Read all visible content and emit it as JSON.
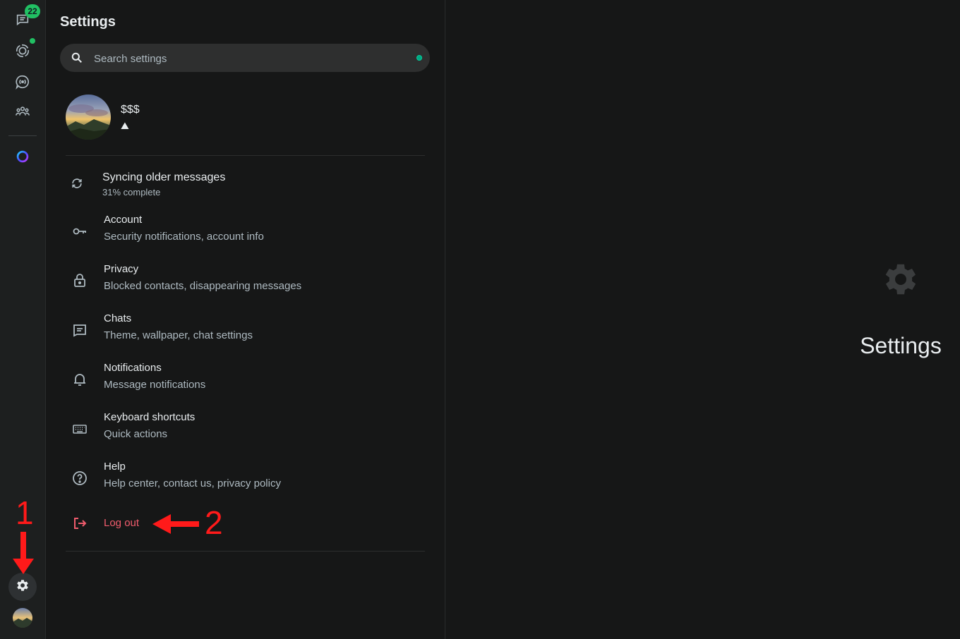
{
  "rail": {
    "chats_badge": "22",
    "items": [
      "chats-icon",
      "status-icon",
      "channels-icon",
      "communities-icon",
      "meta-ai-icon"
    ],
    "settings_icon": "gear-icon"
  },
  "settings": {
    "title": "Settings",
    "search_placeholder": "Search settings",
    "profile": {
      "name": "$$$",
      "about": "⛰"
    },
    "sync": {
      "title": "Syncing older messages",
      "progress": "31% complete",
      "progress_value": 31
    },
    "items": [
      {
        "icon": "key-icon",
        "title": "Account",
        "subtitle": "Security notifications, account info"
      },
      {
        "icon": "lock-icon",
        "title": "Privacy",
        "subtitle": "Blocked contacts, disappearing messages"
      },
      {
        "icon": "chat-icon",
        "title": "Chats",
        "subtitle": "Theme, wallpaper, chat settings"
      },
      {
        "icon": "bell-icon",
        "title": "Notifications",
        "subtitle": "Message notifications"
      },
      {
        "icon": "keyboard-icon",
        "title": "Keyboard shortcuts",
        "subtitle": "Quick actions"
      },
      {
        "icon": "help-icon",
        "title": "Help",
        "subtitle": "Help center, contact us, privacy policy"
      }
    ],
    "logout": "Log out"
  },
  "empty_state": {
    "title": "Settings"
  },
  "annotations": {
    "step1": "1",
    "step2": "2"
  },
  "colors": {
    "accent": "#21c063",
    "danger": "#f15c6d",
    "annotation": "#ff1a1a"
  }
}
